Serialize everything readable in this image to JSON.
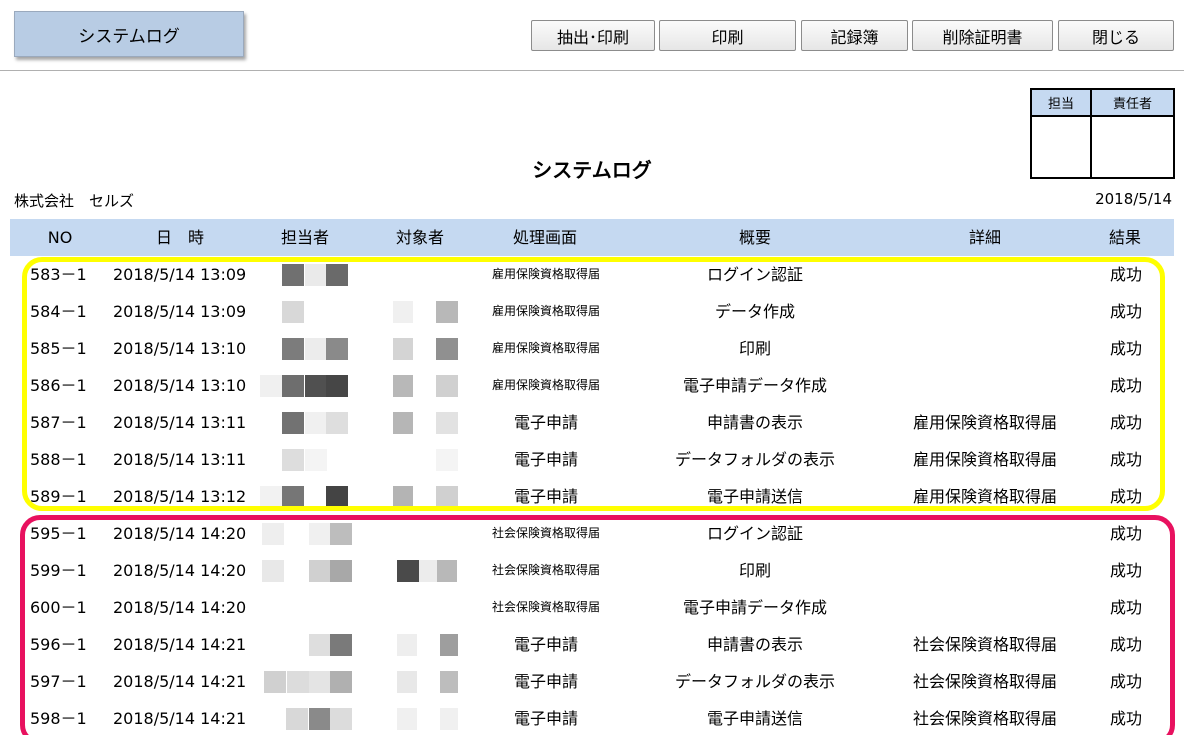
{
  "header": {
    "title_tab": "システムログ",
    "buttons": [
      "抽出･印刷",
      "印刷",
      "記録簿",
      "削除証明書",
      "閉じる"
    ]
  },
  "stamp": {
    "col1": "担当",
    "col2": "責任者"
  },
  "document": {
    "title": "システムログ",
    "company": "株式会社　セルズ",
    "date": "2018/5/14"
  },
  "table": {
    "columns": [
      "NO",
      "日　時",
      "担当者",
      "対象者",
      "処理画面",
      "概要",
      "詳細",
      "結果"
    ],
    "rows": [
      {
        "no": "583－1",
        "datetime": "2018/5/14 13:09",
        "screen": "雇用保険資格取得届",
        "summary": "ログイン認証",
        "detail": "",
        "result": "成功"
      },
      {
        "no": "584－1",
        "datetime": "2018/5/14 13:09",
        "screen": "雇用保険資格取得届",
        "summary": "データ作成",
        "detail": "",
        "result": "成功"
      },
      {
        "no": "585－1",
        "datetime": "2018/5/14 13:10",
        "screen": "雇用保険資格取得届",
        "summary": "印刷",
        "detail": "",
        "result": "成功"
      },
      {
        "no": "586－1",
        "datetime": "2018/5/14 13:10",
        "screen": "雇用保険資格取得届",
        "summary": "電子申請データ作成",
        "detail": "",
        "result": "成功"
      },
      {
        "no": "587－1",
        "datetime": "2018/5/14 13:11",
        "screen": "電子申請",
        "summary": "申請書の表示",
        "detail": "雇用保険資格取得届",
        "result": "成功"
      },
      {
        "no": "588－1",
        "datetime": "2018/5/14 13:11",
        "screen": "電子申請",
        "summary": "データフォルダの表示",
        "detail": "雇用保険資格取得届",
        "result": "成功"
      },
      {
        "no": "589－1",
        "datetime": "2018/5/14 13:12",
        "screen": "電子申請",
        "summary": "電子申請送信",
        "detail": "雇用保険資格取得届",
        "result": "成功"
      },
      {
        "no": "595－1",
        "datetime": "2018/5/14 14:20",
        "screen": "社会保険資格取得届",
        "summary": "ログイン認証",
        "detail": "",
        "result": "成功"
      },
      {
        "no": "599－1",
        "datetime": "2018/5/14 14:20",
        "screen": "社会保険資格取得届",
        "summary": "印刷",
        "detail": "",
        "result": "成功"
      },
      {
        "no": "600－1",
        "datetime": "2018/5/14 14:20",
        "screen": "社会保険資格取得届",
        "summary": "電子申請データ作成",
        "detail": "",
        "result": "成功"
      },
      {
        "no": "596－1",
        "datetime": "2018/5/14 14:21",
        "screen": "電子申請",
        "summary": "申請書の表示",
        "detail": "社会保険資格取得届",
        "result": "成功"
      },
      {
        "no": "597－1",
        "datetime": "2018/5/14 14:21",
        "screen": "電子申請",
        "summary": "データフォルダの表示",
        "detail": "社会保険資格取得届",
        "result": "成功"
      },
      {
        "no": "598－1",
        "datetime": "2018/5/14 14:21",
        "screen": "電子申請",
        "summary": "電子申請送信",
        "detail": "社会保険資格取得届",
        "result": "成功"
      }
    ]
  },
  "colors": {
    "header_bg": "#c5d9f1",
    "title_tab_bg": "#b8cce4",
    "highlight_yellow": "#ffff00",
    "highlight_red": "#e8115f"
  }
}
